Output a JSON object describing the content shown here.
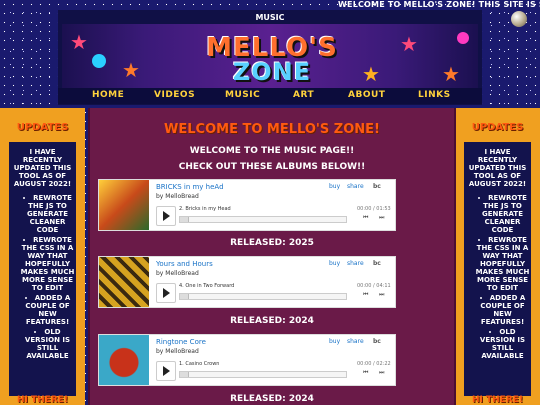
{
  "marquee": "WELCOME TO MELLO'S ZONE! THIS SITE IS STILL",
  "header": {
    "title": "MUSIC",
    "logo_line1": "MELLO'S",
    "logo_line2": "ZONE"
  },
  "nav": [
    "HOME",
    "VIDEOS",
    "MUSIC",
    "ART",
    "ABOUT",
    "LINKS"
  ],
  "sidebar_left": {
    "heading": "UPDATES",
    "intro": "I HAVE RECENTLY UPDATED THIS TOOL AS OF AUGUST 2022!",
    "items": [
      "REWROTE THE JS TO GENERATE CLEANER CODE",
      "REWROTE THE CSS IN A WAY THAT HOPEFULLY MAKES MUCH MORE SENSE TO EDIT",
      "ADDED A COUPLE OF NEW FEATURES!",
      "OLD VERSION IS STILL AVAILABLE"
    ],
    "footer": "HI THERE!"
  },
  "sidebar_right": {
    "heading": "UPDATES",
    "intro": "I HAVE RECENTLY UPDATED THIS TOOL AS OF AUGUST 2022!",
    "items": [
      "REWROTE THE JS TO GENERATE CLEANER CODE",
      "REWROTE THE CSS IN A WAY THAT HOPEFULLY MAKES MUCH MORE SENSE TO EDIT",
      "ADDED A COUPLE OF NEW FEATURES!",
      "OLD VERSION IS STILL AVAILABLE"
    ],
    "footer": "HI THERE!"
  },
  "main": {
    "welcome": "WELCOME TO MELLO'S ZONE!",
    "sub1": "WELCOME TO THE MUSIC PAGE!!",
    "sub2": "CHECK OUT THESE ALBUMS BELOW!!"
  },
  "albums": [
    {
      "title": "BRICKS in my heAd",
      "artist": "by MelloBread",
      "track": "2.   Bricks in my Head",
      "time": "00:00 / 01:53",
      "released": "RELEASED: 2025",
      "art_color": "#c84a1a"
    },
    {
      "title": "Yours and Hours",
      "artist": "by MelloBread",
      "track": "4.   One in Two Forward",
      "time": "00:00 / 04:11",
      "released": "RELEASED: 2024",
      "art_color": "#d6a320"
    },
    {
      "title": "Ringtone Core",
      "artist": "by MelloBread",
      "track": "1.   Casino Crown",
      "time": "00:00 / 02:22",
      "released": "RELEASED: 2024",
      "art_color": "#3aa8c8"
    }
  ],
  "player_labels": {
    "buy": "buy",
    "share": "share",
    "bc": "bc",
    "prev": "⏮",
    "next": "⏭"
  }
}
